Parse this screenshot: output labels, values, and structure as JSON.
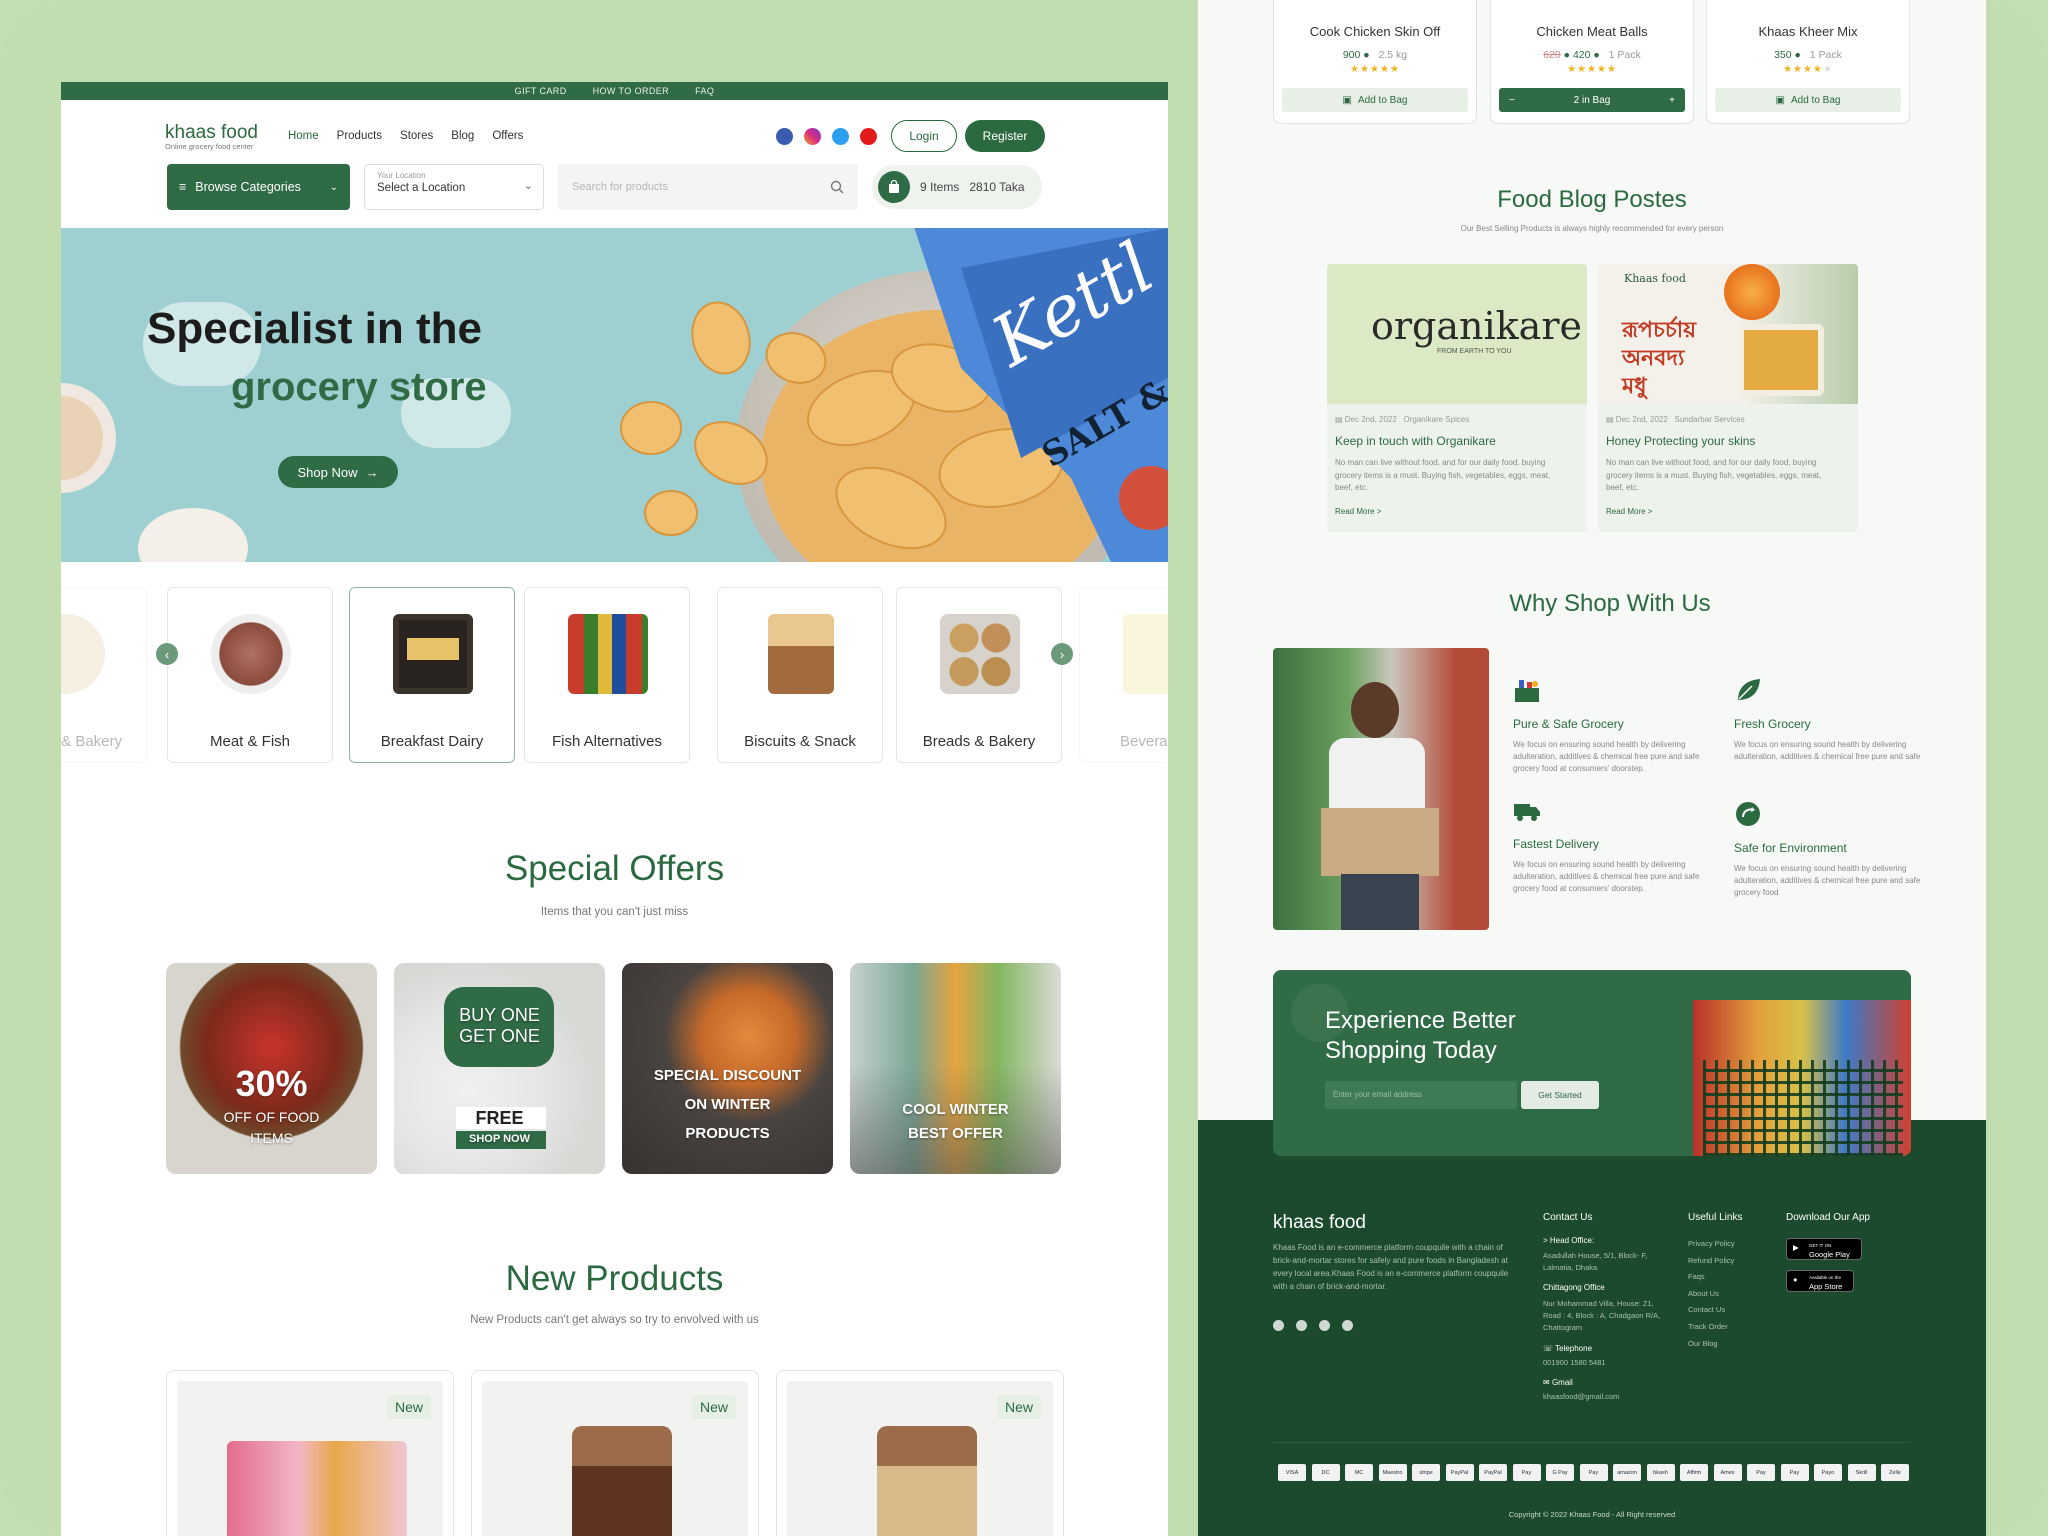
{
  "top_links": [
    "GIFT CARD",
    "HOW TO ORDER",
    "FAQ"
  ],
  "brand": {
    "name": "khaas food",
    "tagline": "Online grocery food center"
  },
  "nav": [
    "Home",
    "Products",
    "Stores",
    "Blog",
    "Offers"
  ],
  "auth": {
    "login": "Login",
    "register": "Register"
  },
  "browse_label": "Browse Categories",
  "location": {
    "label": "Your Location",
    "value": "Select a Location"
  },
  "search": {
    "placeholder": "Search for products"
  },
  "cart": {
    "items": "9 Items",
    "total": "2810 Taka"
  },
  "hero": {
    "line1": "Specialist in the",
    "line2": "grocery store",
    "cta": "Shop Now"
  },
  "categories": [
    "& Bakery",
    "Meat & Fish",
    "Breakfast Dairy",
    "Fish Alternatives",
    "Biscuits & Snack",
    "Breads & Bakery",
    "Bevera"
  ],
  "special": {
    "title": "Special Offers",
    "subtitle": "Items that you can't just miss",
    "offers": [
      {
        "a": "30%",
        "b": "OFF OF FOOD",
        "c": "ITEMS"
      },
      {
        "a": "BUY ONE",
        "b": "GET ONE",
        "c": "FREE",
        "d": "SHOP NOW"
      },
      {
        "a": "SPECIAL DISCOUNT",
        "b": "ON WINTER",
        "c": "PRODUCTS"
      },
      {
        "a": "COOL WINTER",
        "b": "BEST OFFER"
      }
    ]
  },
  "new_products": {
    "title": "New Products",
    "subtitle": "New Products can't get always so try to envolved with us",
    "badge": "New"
  },
  "products": [
    {
      "name": "Cook Chicken Skin Off",
      "price": "900",
      "unit": "2.5 kg",
      "old": "",
      "action": "Add to Bag"
    },
    {
      "name": "Chicken Meat Balls",
      "price": "420",
      "unit": "1 Pack",
      "old": "620",
      "action": "2 in Bag"
    },
    {
      "name": "Khaas Kheer Mix",
      "price": "350",
      "unit": "1 Pack",
      "old": "",
      "action": "Add to Bag"
    }
  ],
  "blog": {
    "title": "Food Blog Postes",
    "subtitle": "Our Best Selling Products is always highly recommended for every person",
    "posts": [
      {
        "date": "Dec 2nd, 2022",
        "cat": "Organikare Spices",
        "title": "Keep in touch with Organikare",
        "brand": "organikare",
        "brand_sub": "FROM EARTH TO YOU",
        "desc": "No man can live without food, and for our daily food, buying grocery items is a must. Buying fish, vegetables, eggs, meat, beef, etc.",
        "more": "Read More  >"
      },
      {
        "date": "Dec 2nd, 2022",
        "cat": "Sundarbar Services",
        "title": "Honey Protecting your skins",
        "brand": "Khaas food",
        "brand_sub": "রূপচর্চায় অনবদ্য মধু",
        "desc": "No man can live without food, and for our daily food, buying grocery items is a must. Buying fish, vegetables, eggs, meat, beef, etc.",
        "more": "Read More  >"
      }
    ]
  },
  "why": {
    "title": "Why Shop With Us",
    "items": [
      {
        "t": "Pure & Safe Grocery",
        "d": "We focus on ensuring sound health by delivering adulteration, additives & chemical free pure and safe grocery food at consumers' doorstep."
      },
      {
        "t": "Fresh Grocery",
        "d": "We focus on ensuring sound health by delivering adulteration, additives & chemical free pure and safe"
      },
      {
        "t": "Fastest Delivery",
        "d": "We focus on ensuring sound health by delivering adulteration, additives & chemical free pure and safe grocery food at consumers' doorstep."
      },
      {
        "t": "Safe for Environment",
        "d": "We focus on ensuring sound health by delivering adulteration, additives & chemical free pure and safe grocery food"
      }
    ]
  },
  "cta": {
    "line1": "Experience Better",
    "line2": "Shopping Today",
    "placeholder": "Enter your email address",
    "button": "Get Started"
  },
  "footer": {
    "brand": "khaas food",
    "about": "Khaas Food is an e-commerce platform coupquile with a chain of brick-and-mortar stores for safely and pure foods in Bangladesh at every local area.Khaas Food is an e-commerce platform coupquile with a chain of brick-and-mortar.",
    "contact_title": "Contact Us",
    "head_label": "> Head Office:",
    "head_addr": "Asadullah House, 5/1, Block- F, Lalmatia, Dhaka",
    "ctg_label": "Chittagong Office",
    "ctg_addr": "Nur Mohammad Villa, House: Z1, Road : 4, Block : A, Chadgaon R/A, Chattogram",
    "tel_label": "Telephone",
    "tel": "001900 1580 5481",
    "mail_label": "Gmail",
    "mail": "khaasfood@gmail.com",
    "links_title": "Useful Links",
    "links": [
      "Privacy Policy",
      "Refund Policy",
      "Faqs",
      "About Us",
      "Contact Us",
      "Track Order",
      "Our Blog"
    ],
    "app_title": "Download Our App",
    "gp": "Google Play",
    "as": "App Store",
    "gp_small": "GET IT ON",
    "as_small": "Available on the",
    "copyright": "Copyright © 2022 Khaas Food - All Right reserved",
    "pay": [
      "VISA",
      "DC",
      "MC",
      "Maestro",
      "stripe",
      "PayPal",
      "PayPal",
      "Pay",
      "G Pay",
      "Pay",
      "amazon",
      "bkash",
      "Affirm",
      "Amex",
      "Pay",
      "Pay",
      "Payo",
      "Skrill",
      "Zelle"
    ]
  },
  "colors": {
    "brand_green": "#2b6a40",
    "dark_green": "#1c4a2c",
    "background": "#c4dfb4"
  }
}
